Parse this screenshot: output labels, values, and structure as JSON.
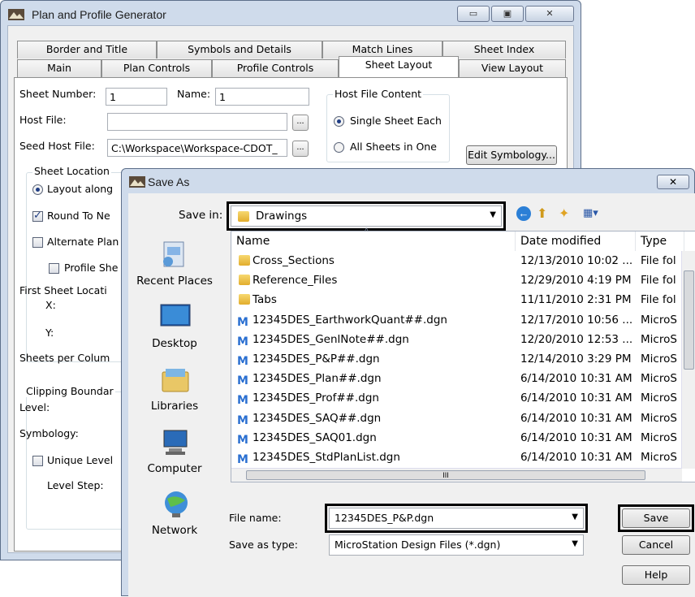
{
  "main_window": {
    "title": "Plan and Profile Generator",
    "tabs_row1": [
      "Border and Title",
      "Symbols and Details",
      "Match Lines",
      "Sheet Index"
    ],
    "tabs_row2": [
      "Main",
      "Plan Controls",
      "Profile Controls",
      "Sheet Layout",
      "View Layout"
    ],
    "active_tab": "Sheet Layout",
    "sheet_number_label": "Sheet Number:",
    "sheet_number_value": "1",
    "name_label": "Name:",
    "name_value": "1",
    "host_file_label": "Host File:",
    "host_file_value": "",
    "seed_host_file_label": "Seed Host File:",
    "seed_host_file_value": "C:\\Workspace\\Workspace-CDOT_",
    "browse_label": "...",
    "host_file_content": {
      "title": "Host File Content",
      "option_single": "Single Sheet Each",
      "option_all": "All Sheets in One"
    },
    "edit_symbology_label": "Edit Symbology...",
    "sheet_location_title": "Sheet Location",
    "layout_along_label": "Layout along",
    "round_to_label": "Round To Ne",
    "alternate_plan_label": "Alternate Plan",
    "profile_sheet_label": "Profile She",
    "first_sheet_location_label": "First Sheet Locati",
    "x_label": "X:",
    "y_label": "Y:",
    "sheets_per_column_label": "Sheets per Colum",
    "clipping_boundary_title": "Clipping Boundar",
    "level_label": "Level:",
    "symbology_label": "Symbology:",
    "unique_level_label": "Unique Level",
    "level_step_label": "Level Step:"
  },
  "save_as": {
    "title": "Save As",
    "save_in_label": "Save in:",
    "save_in_value": "Drawings",
    "places": [
      "Recent Places",
      "Desktop",
      "Libraries",
      "Computer",
      "Network"
    ],
    "columns": [
      "Name",
      "Date modified",
      "Type"
    ],
    "files": [
      {
        "name": "Cross_Sections",
        "date": "12/13/2010 10:02 ...",
        "type": "File fol",
        "kind": "folder"
      },
      {
        "name": "Reference_Files",
        "date": "12/29/2010 4:19 PM",
        "type": "File fol",
        "kind": "folder"
      },
      {
        "name": "Tabs",
        "date": "11/11/2010 2:31 PM",
        "type": "File fol",
        "kind": "folder"
      },
      {
        "name": "12345DES_EarthworkQuant##.dgn",
        "date": "12/17/2010 10:56 ...",
        "type": "MicroS",
        "kind": "dgn"
      },
      {
        "name": "12345DES_GenlNote##.dgn",
        "date": "12/20/2010 12:53 ...",
        "type": "MicroS",
        "kind": "dgn"
      },
      {
        "name": "12345DES_P&P##.dgn",
        "date": "12/14/2010 3:29 PM",
        "type": "MicroS",
        "kind": "dgn"
      },
      {
        "name": "12345DES_Plan##.dgn",
        "date": "6/14/2010 10:31 AM",
        "type": "MicroS",
        "kind": "dgn"
      },
      {
        "name": "12345DES_Prof##.dgn",
        "date": "6/14/2010 10:31 AM",
        "type": "MicroS",
        "kind": "dgn"
      },
      {
        "name": "12345DES_SAQ##.dgn",
        "date": "6/14/2010 10:31 AM",
        "type": "MicroS",
        "kind": "dgn"
      },
      {
        "name": "12345DES_SAQ01.dgn",
        "date": "6/14/2010 10:31 AM",
        "type": "MicroS",
        "kind": "dgn"
      },
      {
        "name": "12345DES_StdPlanList.dgn",
        "date": "6/14/2010 10:31 AM",
        "type": "MicroS",
        "kind": "dgn"
      }
    ],
    "file_name_label": "File name:",
    "file_name_value": "12345DES_P&P.dgn",
    "save_as_type_label": "Save as type:",
    "save_as_type_value": "MicroStation Design Files (*.dgn)",
    "save_label": "Save",
    "cancel_label": "Cancel",
    "help_label": "Help",
    "scroll_mark": "III"
  }
}
